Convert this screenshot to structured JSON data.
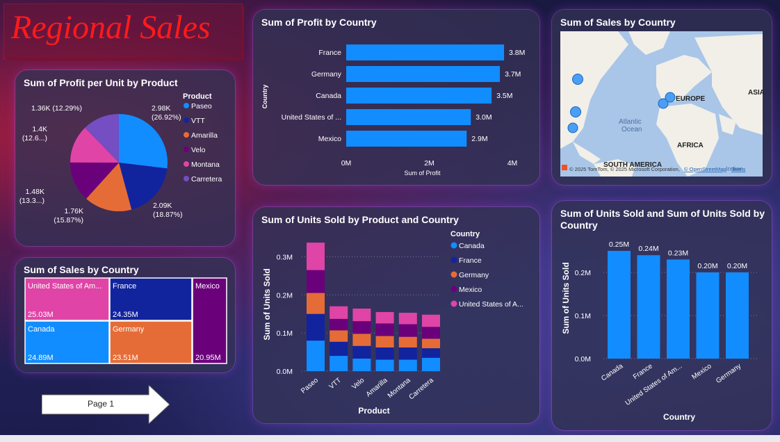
{
  "title": "Regional Sales",
  "pie": {
    "title": "Sum of Profit per Unit by Product",
    "legend_title": "Product",
    "slices": [
      {
        "name": "Paseo",
        "value": 2.98,
        "color": "#118dff",
        "label1": "2.98K",
        "label2": "(26.92%)"
      },
      {
        "name": "VTT",
        "value": 2.09,
        "color": "#12239e",
        "label1": "2.09K",
        "label2": "(18.87%)"
      },
      {
        "name": "Amarilla",
        "value": 1.76,
        "color": "#e66c37",
        "label1": "1.76K",
        "label2": "(15.87%)"
      },
      {
        "name": "Velo",
        "value": 1.48,
        "color": "#6b007b",
        "label1": "1.48K",
        "label2": "(13.3...)"
      },
      {
        "name": "Montana",
        "value": 1.4,
        "color": "#e044a7",
        "label1": "1.4K",
        "label2": "(12.6...)"
      },
      {
        "name": "Carretera",
        "value": 1.36,
        "color": "#744ec2",
        "label1": "1.36K (12.29%)",
        "label2": ""
      }
    ]
  },
  "treemap": {
    "title": "Sum of Sales by Country",
    "cells": [
      {
        "name": "United States of Am...",
        "value": "25.03M",
        "color": "#e044a7"
      },
      {
        "name": "France",
        "value": "24.35M",
        "color": "#12239e"
      },
      {
        "name": "Mexico",
        "value": "20.95M",
        "color": "#6b007b"
      },
      {
        "name": "Canada",
        "value": "24.89M",
        "color": "#118dff"
      },
      {
        "name": "Germany",
        "value": "23.51M",
        "color": "#e66c37"
      }
    ]
  },
  "page_button": {
    "label": "Page 1"
  },
  "profit_bar": {
    "title": "Sum of Profit by Country",
    "ylabel": "Country",
    "xlabel": "Sum of Profit",
    "ticks": [
      "0M",
      "2M",
      "4M"
    ],
    "color": "#118dff"
  },
  "map": {
    "title": "Sum of Sales by Country",
    "labels": {
      "europe": "EUROPE",
      "asia": "ASIA",
      "atlantic1": "Atlantic",
      "atlantic2": "Ocean",
      "africa": "AFRICA",
      "south_america": "SOUTH AMERICA",
      "indian": "Indian"
    },
    "attribution": "© 2025 TomTom, © 2025 Microsoft Corporation,",
    "attribution_link": "© OpenStreetMap",
    "attribution_terms": "Terms"
  },
  "stacked": {
    "title": "Sum of Units Sold by Product and Country",
    "ylabel": "Sum of Units Sold",
    "xlabel": "Product",
    "legend_title": "Country",
    "yticks": [
      "0.0M",
      "0.1M",
      "0.2M",
      "0.3M"
    ]
  },
  "units_bar": {
    "title": "Sum of Units Sold and Sum of Units Sold by Country",
    "ylabel": "Sum of Units Sold",
    "xlabel": "Country",
    "yticks": [
      "0.0M",
      "0.1M",
      "0.2M"
    ],
    "color": "#118dff"
  },
  "chart_data": [
    {
      "type": "pie",
      "title": "Sum of Profit per Unit by Product",
      "categories": [
        "Paseo",
        "VTT",
        "Amarilla",
        "Velo",
        "Montana",
        "Carretera"
      ],
      "values": [
        2.98,
        2.09,
        1.76,
        1.48,
        1.4,
        1.36
      ],
      "unit": "K",
      "percent": [
        26.92,
        18.87,
        15.87,
        13.3,
        12.6,
        12.29
      ]
    },
    {
      "type": "treemap",
      "title": "Sum of Sales by Country",
      "categories": [
        "United States of America",
        "France",
        "Canada",
        "Germany",
        "Mexico"
      ],
      "values": [
        25.03,
        24.35,
        24.89,
        23.51,
        20.95
      ],
      "unit": "M"
    },
    {
      "type": "bar",
      "orientation": "horizontal",
      "title": "Sum of Profit by Country",
      "categories": [
        "France",
        "Germany",
        "Canada",
        "United States of ...",
        "Mexico"
      ],
      "values": [
        3.8,
        3.7,
        3.5,
        3.0,
        2.9
      ],
      "labels": [
        "3.8M",
        "3.7M",
        "3.5M",
        "3.0M",
        "2.9M"
      ],
      "xlabel": "Sum of Profit",
      "ylabel": "Country",
      "xlim": [
        0,
        4
      ]
    },
    {
      "type": "bar",
      "stacked": true,
      "title": "Sum of Units Sold by Product and Country",
      "categories": [
        "Paseo",
        "VTT",
        "Velo",
        "Amarilla",
        "Montana",
        "Carretera"
      ],
      "series": [
        {
          "name": "Canada",
          "color": "#118dff",
          "values": [
            0.08,
            0.04,
            0.033,
            0.03,
            0.03,
            0.035
          ]
        },
        {
          "name": "France",
          "color": "#12239e",
          "values": [
            0.07,
            0.037,
            0.033,
            0.032,
            0.032,
            0.025
          ]
        },
        {
          "name": "Germany",
          "color": "#e66c37",
          "values": [
            0.055,
            0.03,
            0.032,
            0.03,
            0.028,
            0.025
          ]
        },
        {
          "name": "Mexico",
          "color": "#6b007b",
          "values": [
            0.06,
            0.03,
            0.033,
            0.033,
            0.033,
            0.031
          ]
        },
        {
          "name": "United States of A...",
          "color": "#e044a7",
          "values": [
            0.072,
            0.033,
            0.033,
            0.03,
            0.03,
            0.032
          ]
        }
      ],
      "xlabel": "Product",
      "ylabel": "Sum of Units Sold",
      "ylim": [
        0,
        0.35
      ]
    },
    {
      "type": "bar",
      "title": "Sum of Units Sold and Sum of Units Sold by Country",
      "categories": [
        "Canada",
        "France",
        "United States of Am...",
        "Mexico",
        "Germany"
      ],
      "values": [
        0.25,
        0.24,
        0.23,
        0.2,
        0.2
      ],
      "labels": [
        "0.25M",
        "0.24M",
        "0.23M",
        "0.20M",
        "0.20M"
      ],
      "xlabel": "Country",
      "ylabel": "Sum of Units Sold",
      "ylim": [
        0,
        0.26
      ]
    }
  ]
}
